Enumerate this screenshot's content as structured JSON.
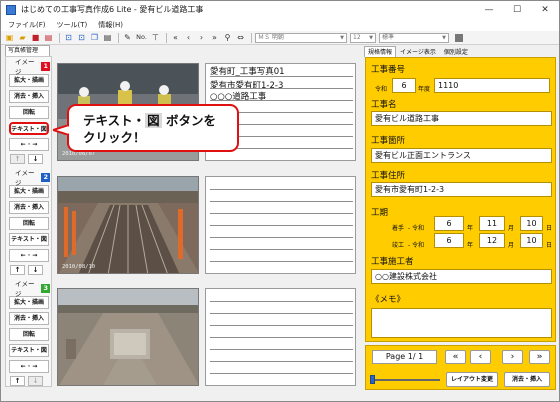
{
  "window": {
    "title": "はじめての工事写真作成6 Lite - 愛有ビル道路工事",
    "controls": {
      "minimize": "—",
      "maximize": "☐",
      "close": "✕"
    }
  },
  "menu": [
    "ファイル(F)",
    "ツール(T)",
    "情報(H)"
  ],
  "toolbar": {
    "font_name": "ＭＳ 明朝",
    "font_size": "12",
    "style": "標準",
    "no_label": "No."
  },
  "left_panel": {
    "tab_label": "写真帳管理",
    "groups": [
      {
        "label": "イメージ",
        "num": "1",
        "expand": "拡大・描画",
        "erase": "消去・挿入",
        "rotate": "回転",
        "text": "テキスト・図"
      },
      {
        "label": "イメージ",
        "num": "2",
        "expand": "拡大・描画",
        "erase": "消去・挿入",
        "rotate": "回転",
        "text": "テキスト・図"
      },
      {
        "label": "イメージ",
        "num": "3",
        "expand": "拡大・描画",
        "erase": "消去・挿入",
        "rotate": "回転",
        "text": "テキスト・図"
      }
    ],
    "arrows": {
      "lr": "← · →",
      "up": "↑",
      "down": "↓"
    },
    "num_color": "#e01020",
    "num_color_alt": "#1f5fc8",
    "num_color_3": "#32a832"
  },
  "photos": [
    {
      "caption": "2010/08/07"
    },
    {
      "caption": "2010/08/10"
    },
    {
      "caption": ""
    }
  ],
  "sheet1": {
    "lines": [
      "愛有町_工事写真01",
      "愛有市愛有町1-2-3",
      "○○○道路工事"
    ]
  },
  "callout": {
    "line1_pre": "テキスト・",
    "line1_box": "図",
    "line1_post": " ボタンを",
    "line2": "クリック！"
  },
  "right_tabs": [
    "規格情報",
    "イメージ表示",
    "個別設定"
  ],
  "form": {
    "koji_bango_label": "工事番号",
    "era_label": "令和",
    "year_value": "6",
    "year_suffix": "年度",
    "number_value": "1110",
    "koji_mei_label": "工事名",
    "koji_mei_value": "愛有ビル道路工事",
    "koji_kasho_label": "工事箇所",
    "koji_kasho_value": "愛有ビル正面エントランス",
    "koji_jusho_label": "工事住所",
    "koji_jusho_value": "愛有市愛有町1-2-3",
    "koki_label": "工期",
    "start_label": "着手",
    "end_label": "竣工",
    "era_prefix": "- 令和",
    "start_year": "6",
    "start_month": "11",
    "start_day": "10",
    "end_year": "6",
    "end_month": "12",
    "end_day": "10",
    "year_unit": "年",
    "month_unit": "月",
    "day_unit": "日",
    "sekosha_label": "工事施工者",
    "sekosha_value": "○○建設株式会社",
    "memo_label": "《メモ》",
    "memo_value": ""
  },
  "nav": {
    "page_text": "Page 1/ 1",
    "first": "«",
    "prev": "‹",
    "next": "›",
    "last": "»",
    "layout_btn": "レイアウト変更",
    "erase_btn": "消去・挿入",
    "zoom_level": 0.05
  },
  "colors": {
    "form_bg": "#ffcc00",
    "accent_red": "#e01010"
  }
}
